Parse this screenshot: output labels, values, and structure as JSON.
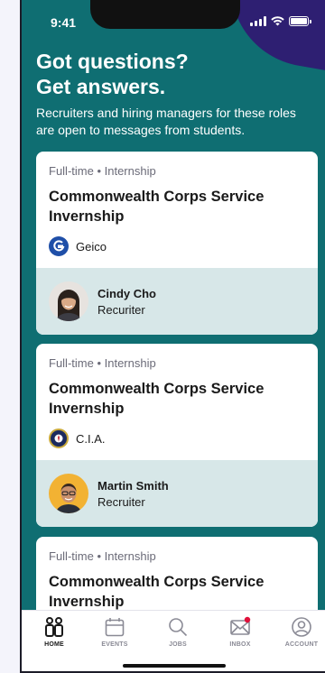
{
  "status_bar": {
    "time": "9:41"
  },
  "header": {
    "headline_line1": "Got questions?",
    "headline_line2": "Get answers.",
    "subtitle": "Recruiters and hiring managers for these roles are open to messages from students."
  },
  "cards": [
    {
      "job_type": "Full-time • Internship",
      "title": "Commonwealth Corps Service Invernship",
      "company": "Geico",
      "recruiter_name": "Cindy Cho",
      "recruiter_role": "Recuriter"
    },
    {
      "job_type": "Full-time • Internship",
      "title": "Commonwealth Corps Service Invernship",
      "company": "C.I.A.",
      "recruiter_name": "Martin Smith",
      "recruiter_role": "Recruiter"
    },
    {
      "job_type": "Full-time • Internship",
      "title": "Commonwealth Corps Service Invernship"
    }
  ],
  "tabbar": {
    "tabs": [
      {
        "label": "HOME",
        "icon": "home-people-icon",
        "active": true
      },
      {
        "label": "EVENTS",
        "icon": "calendar-icon"
      },
      {
        "label": "JOBS",
        "icon": "search-icon"
      },
      {
        "label": "INBOX",
        "icon": "mail-icon",
        "badge": true
      },
      {
        "label": "ACCOUNT",
        "icon": "account-icon"
      }
    ]
  },
  "colors": {
    "hero": "#0f6e72",
    "corner": "#2e1f72",
    "recruiter_band": "#d7e7e8",
    "badge": "#e0103a"
  }
}
